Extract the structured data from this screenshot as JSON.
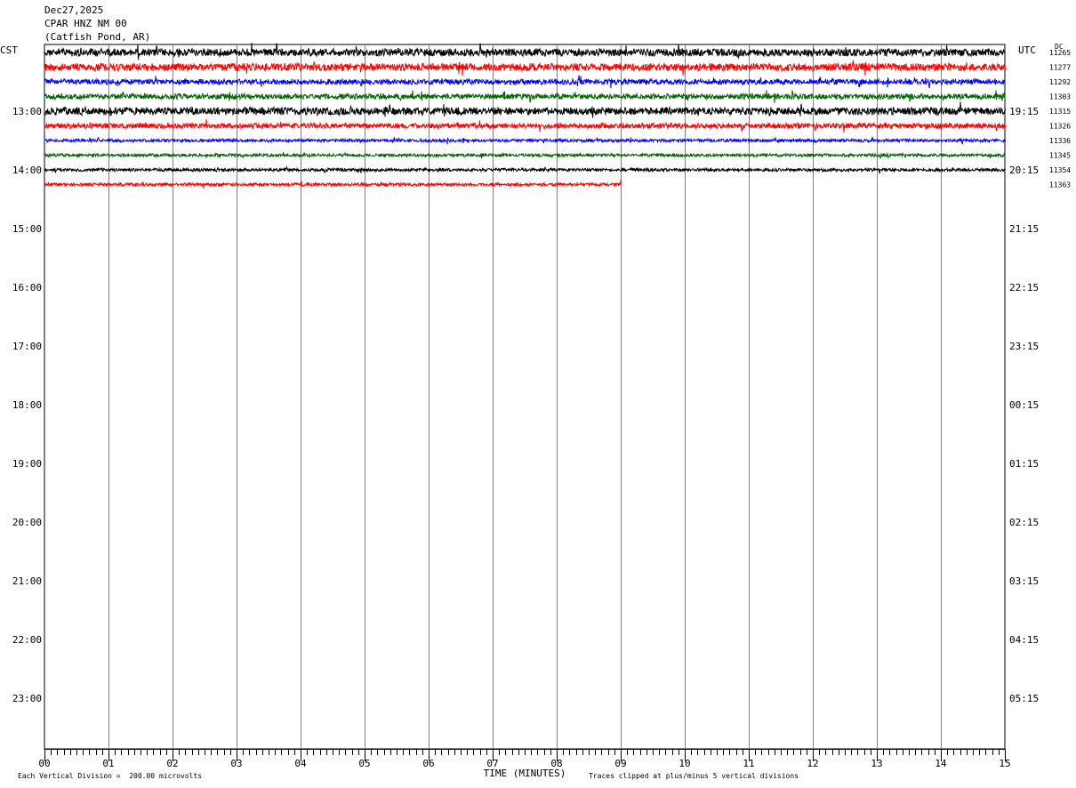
{
  "header": {
    "date": "Dec27,2025",
    "station": "CPAR HNZ NM 00",
    "location": "(Catfish Pond, AR)"
  },
  "labels": {
    "left_tz": "CST",
    "right_tz": "UTC",
    "dc": "DC",
    "footer_left": "Each Vertical Division =  200.00 microvolts",
    "footer_right": "Traces clipped at plus/minus 5 vertical divisions"
  },
  "chart_data": {
    "type": "line",
    "title": "CPAR HNZ NM 00",
    "xlabel": "TIME (MINUTES)",
    "ylabel": "",
    "xlim": [
      0,
      15
    ],
    "x_tick_labels": [
      "00",
      "01",
      "02",
      "03",
      "04",
      "05",
      "06",
      "07",
      "08",
      "09",
      "10",
      "11",
      "12",
      "13",
      "14",
      "15"
    ],
    "left_hour_labels": [
      "13:00",
      "14:00",
      "15:00",
      "16:00",
      "17:00",
      "18:00",
      "19:00",
      "20:00",
      "21:00",
      "22:00",
      "23:00"
    ],
    "right_hour_labels": [
      "19:15",
      "20:15",
      "21:15",
      "22:15",
      "23:15",
      "00:15",
      "01:15",
      "02:15",
      "03:15",
      "04:15",
      "05:15"
    ],
    "trace_colors": [
      "#000000",
      "#ff0000",
      "#0000ff",
      "#006400"
    ],
    "grid": true,
    "series": [
      {
        "dc": "11265",
        "end_minute": 15,
        "amplitude": "high"
      },
      {
        "dc": "11277",
        "end_minute": 15,
        "amplitude": "high"
      },
      {
        "dc": "11292",
        "end_minute": 15,
        "amplitude": "medium"
      },
      {
        "dc": "11303",
        "end_minute": 15,
        "amplitude": "medium"
      },
      {
        "dc": "11315",
        "end_minute": 15,
        "amplitude": "high"
      },
      {
        "dc": "11326",
        "end_minute": 15,
        "amplitude": "medium"
      },
      {
        "dc": "11336",
        "end_minute": 15,
        "amplitude": "low"
      },
      {
        "dc": "11345",
        "end_minute": 15,
        "amplitude": "low"
      },
      {
        "dc": "11354",
        "end_minute": 15,
        "amplitude": "low"
      },
      {
        "dc": "11363",
        "end_minute": 9,
        "amplitude": "low"
      }
    ]
  }
}
